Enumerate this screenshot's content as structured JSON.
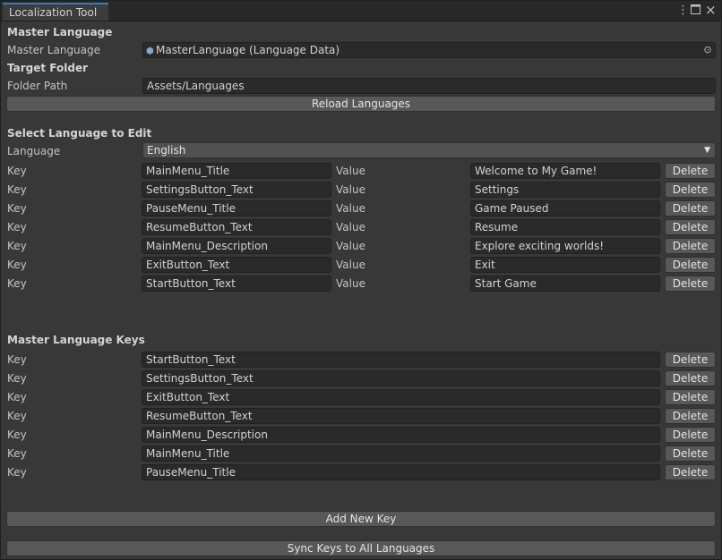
{
  "window": {
    "tab_title": "Localization Tool",
    "menu_icon": "kebab-menu-icon",
    "maximize_icon": "maximize-icon",
    "close_icon": "close-icon"
  },
  "master_language": {
    "section_title": "Master Language",
    "label": "Master Language",
    "value": "MasterLanguage (Language Data)",
    "object_icon": "scriptable-object-icon",
    "picker_icon": "object-picker-icon"
  },
  "target_folder": {
    "section_title": "Target Folder",
    "label": "Folder Path",
    "value": "Assets/Languages"
  },
  "reload_button": "Reload Languages",
  "edit_section": {
    "title": "Select Language to Edit",
    "language_label": "Language",
    "language_value": "English",
    "key_label": "Key",
    "value_label": "Value",
    "delete_label": "Delete",
    "entries": [
      {
        "key": "MainMenu_Title",
        "value": "Welcome to My Game!"
      },
      {
        "key": "SettingsButton_Text",
        "value": "Settings"
      },
      {
        "key": "PauseMenu_Title",
        "value": "Game Paused"
      },
      {
        "key": "ResumeButton_Text",
        "value": "Resume"
      },
      {
        "key": "MainMenu_Description",
        "value": "Explore exciting worlds!"
      },
      {
        "key": "ExitButton_Text",
        "value": "Exit"
      },
      {
        "key": "StartButton_Text",
        "value": "Start Game"
      }
    ]
  },
  "master_keys": {
    "title": "Master Language Keys",
    "key_label": "Key",
    "delete_label": "Delete",
    "keys": [
      "StartButton_Text",
      "SettingsButton_Text",
      "ExitButton_Text",
      "ResumeButton_Text",
      "MainMenu_Description",
      "MainMenu_Title",
      "PauseMenu_Title"
    ]
  },
  "add_key_button": "Add New Key",
  "sync_button": "Sync Keys to All Languages"
}
